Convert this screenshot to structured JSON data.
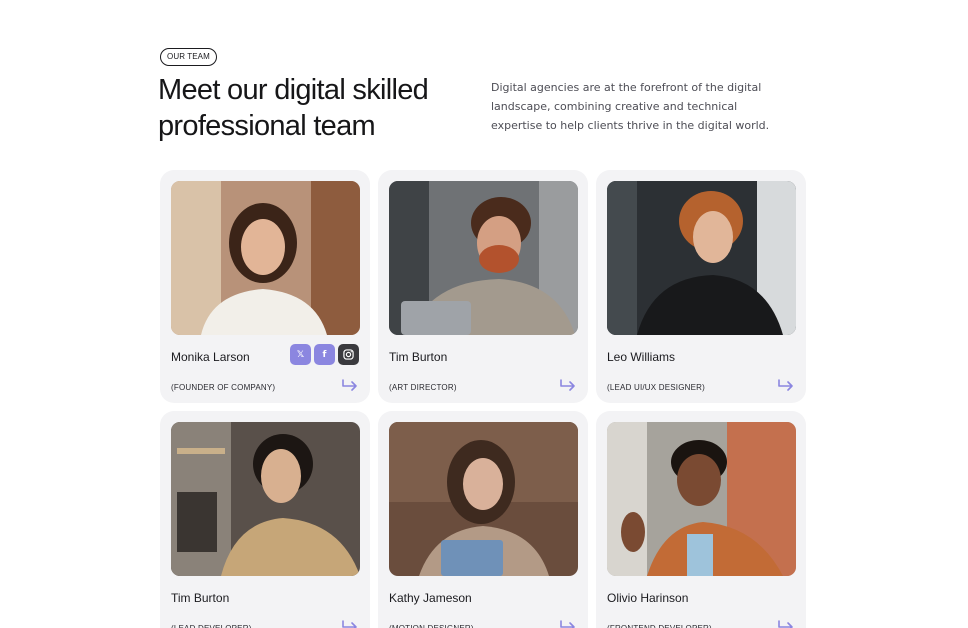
{
  "section": {
    "badge": "OUR TEAM",
    "title": "Meet our digital skilled professional team",
    "intro": "Digital agencies are at the forefront of the digital landscape, combining creative and technical expertise to help clients thrive in the digital world."
  },
  "colors": {
    "accent": "#8b86e0",
    "card_bg": "#f3f3f5",
    "text": "#1b1b1f"
  },
  "socials": [
    {
      "icon": "x-icon",
      "glyph": "𝕏"
    },
    {
      "icon": "facebook-icon",
      "glyph": "f"
    },
    {
      "icon": "instagram-icon",
      "glyph": ""
    }
  ],
  "members": [
    {
      "name": "Monika Larson",
      "role": "(FOUNDER OF COMPANY)"
    },
    {
      "name": "Tim Burton",
      "role": "(ART DIRECTOR)"
    },
    {
      "name": "Leo Williams",
      "role": "(LEAD UI/UX DESIGNER)"
    },
    {
      "name": "Tim Burton",
      "role": "(LEAD DEVELOPER)"
    },
    {
      "name": "Kathy Jameson",
      "role": "(MOTION DESIGNER)"
    },
    {
      "name": "Olivio Harinson",
      "role": "(FRONTEND DEVELOPER)"
    }
  ]
}
